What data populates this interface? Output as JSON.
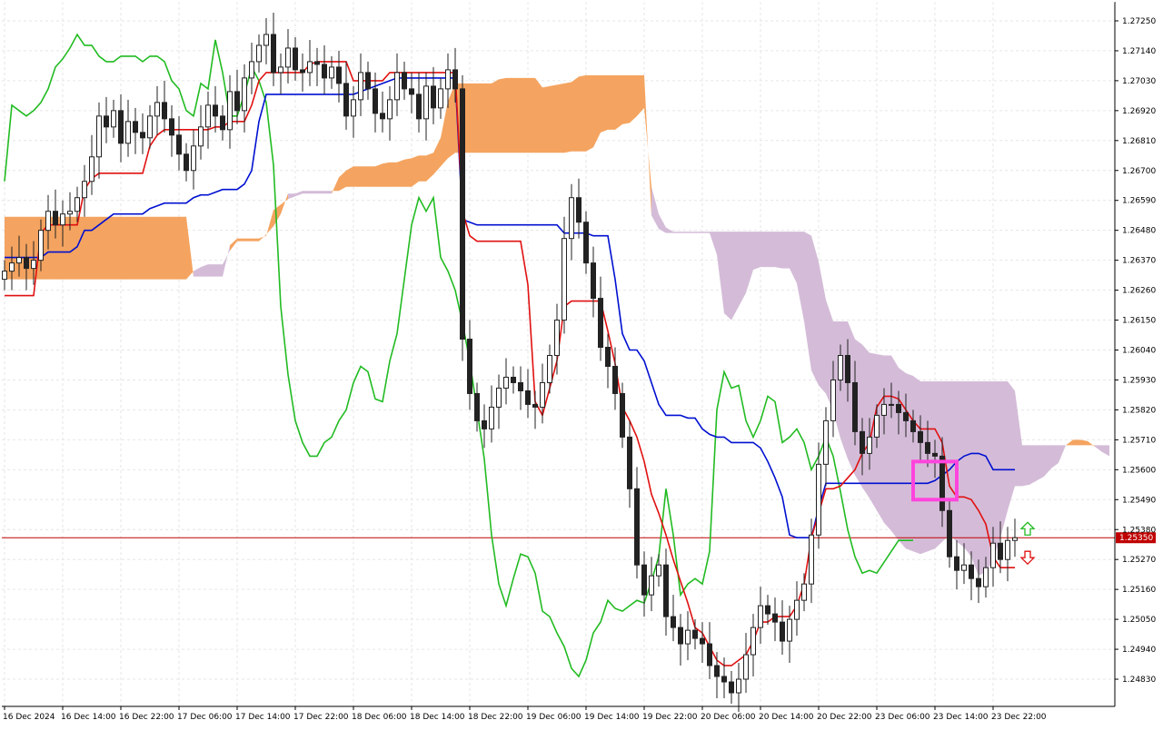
{
  "colors": {
    "background": "#ffffff",
    "grid": "#e6e6e6",
    "axis": "#000000",
    "candle_bull": "#ffffff",
    "candle_bear": "#222222",
    "candle_wick": "#222222",
    "tenkan": "#e01010",
    "kijun": "#0010d0",
    "chikou": "#22bb22",
    "cloud_bull": "#f4a460",
    "cloud_bear": "#d4bcd8",
    "price_line": "#c00000",
    "price_tag_bg": "#c00000",
    "highlight_box": "#ff44dd",
    "arrow_up": "#22bb22",
    "arrow_down": "#e01010"
  },
  "icons": {
    "up_arrow": "up-arrow-icon",
    "down_arrow": "down-arrow-icon"
  },
  "chart_data": {
    "type": "candlestick",
    "symbol": "",
    "y_axis": {
      "ylim": [
        1.2473,
        1.2732
      ],
      "ticks": [
        "1.27250",
        "1.27140",
        "1.27030",
        "1.26920",
        "1.26810",
        "1.26700",
        "1.26590",
        "1.26480",
        "1.26370",
        "1.26260",
        "1.26150",
        "1.26040",
        "1.25930",
        "1.25820",
        "1.25710",
        "1.25600",
        "1.25490",
        "1.25380",
        "1.25270",
        "1.25160",
        "1.25050",
        "1.24940",
        "1.24830"
      ]
    },
    "x_axis": {
      "ticks": [
        "16 Dec 2024",
        "16 Dec 14:00",
        "16 Dec 22:00",
        "17 Dec 06:00",
        "17 Dec 14:00",
        "17 Dec 22:00",
        "18 Dec 06:00",
        "18 Dec 14:00",
        "18 Dec 22:00",
        "19 Dec 06:00",
        "19 Dec 14:00",
        "19 Dec 22:00",
        "20 Dec 06:00",
        "20 Dec 14:00",
        "20 Dec 22:00",
        "23 Dec 06:00",
        "23 Dec 14:00",
        "23 Dec 22:00"
      ],
      "bars_per_tick": 8,
      "n_bars": 140
    },
    "current_price": "1.25350",
    "current_price_value": 1.2535,
    "closes": [
      1.2633,
      1.2636,
      1.2638,
      1.2634,
      1.2637,
      1.2648,
      1.2655,
      1.265,
      1.2654,
      1.2655,
      1.266,
      1.2666,
      1.2675,
      1.269,
      1.2686,
      1.2692,
      1.268,
      1.2688,
      1.2684,
      1.2682,
      1.269,
      1.2695,
      1.2689,
      1.2683,
      1.2676,
      1.267,
      1.2679,
      1.2686,
      1.2694,
      1.269,
      1.2685,
      1.2699,
      1.2692,
      1.2704,
      1.271,
      1.2716,
      1.272,
      1.2706,
      1.2708,
      1.2715,
      1.2707,
      1.2706,
      1.271,
      1.2709,
      1.2704,
      1.2708,
      1.2702,
      1.269,
      1.2696,
      1.2706,
      1.27,
      1.2691,
      1.2689,
      1.2696,
      1.2706,
      1.27,
      1.2698,
      1.2689,
      1.2701,
      1.2693,
      1.27,
      1.2707,
      1.27,
      1.2608,
      1.2588,
      1.2578,
      1.2575,
      1.2583,
      1.259,
      1.2594,
      1.2592,
      1.2589,
      1.2584,
      1.2583,
      1.2592,
      1.2602,
      1.2615,
      1.2645,
      1.266,
      1.2651,
      1.2636,
      1.2623,
      1.2605,
      1.2598,
      1.2588,
      1.2572,
      1.2553,
      1.2525,
      1.2514,
      1.2521,
      1.2525,
      1.2506,
      1.2502,
      1.2496,
      1.2501,
      1.2498,
      1.2496,
      1.2488,
      1.2484,
      1.2482,
      1.2478,
      1.2483,
      1.2492,
      1.2502,
      1.251,
      1.2507,
      1.2504,
      1.2497,
      1.2505,
      1.2512,
      1.2518,
      1.2536,
      1.2562,
      1.2578,
      1.2593,
      1.2602,
      1.2592,
      1.2574,
      1.2566,
      1.2572,
      1.258,
      1.2584,
      1.2584,
      1.2581,
      1.2578,
      1.2574,
      1.257,
      1.2566,
      1.2565,
      1.2545,
      1.2528,
      1.2523,
      1.2525,
      1.252,
      1.2517,
      1.2524,
      1.2533,
      1.2527,
      1.2534,
      1.2535
    ],
    "tenkan": [
      1.2624,
      1.2624,
      1.2624,
      1.2624,
      1.2624,
      1.2647,
      1.265,
      1.265,
      1.265,
      1.265,
      1.265,
      1.2663,
      1.2667,
      1.2669,
      1.2669,
      1.2669,
      1.2669,
      1.2669,
      1.2669,
      1.2669,
      1.2679,
      1.2683,
      1.2685,
      1.2685,
      1.2685,
      1.2685,
      1.2685,
      1.2685,
      1.2685,
      1.2686,
      1.2686,
      1.2688,
      1.2688,
      1.2688,
      1.2694,
      1.2703,
      1.2706,
      1.2706,
      1.2706,
      1.2706,
      1.2706,
      1.2706,
      1.2709,
      1.271,
      1.271,
      1.271,
      1.271,
      1.271,
      1.2703,
      1.2703,
      1.2703,
      1.2703,
      1.2703,
      1.2706,
      1.2706,
      1.2706,
      1.2706,
      1.2706,
      1.2706,
      1.2706,
      1.2706,
      1.2706,
      1.2706,
      1.2655,
      1.2646,
      1.2644,
      1.2644,
      1.2644,
      1.2644,
      1.2644,
      1.2644,
      1.2644,
      1.2628,
      1.2585,
      1.258,
      1.259,
      1.26,
      1.262,
      1.2622,
      1.2622,
      1.2622,
      1.2622,
      1.2622,
      1.2611,
      1.2599,
      1.2583,
      1.2578,
      1.2572,
      1.2563,
      1.2551,
      1.2544,
      1.2536,
      1.2527,
      1.2519,
      1.2511,
      1.2502,
      1.25,
      1.2495,
      1.249,
      1.2488,
      1.2488,
      1.249,
      1.2492,
      1.2497,
      1.2504,
      1.2504,
      1.2506,
      1.2506,
      1.2506,
      1.251,
      1.2518,
      1.2535,
      1.2544,
      1.2553,
      1.2553,
      1.2554,
      1.2557,
      1.256,
      1.2566,
      1.257,
      1.2583,
      1.2587,
      1.2587,
      1.2586,
      1.2582,
      1.2578,
      1.2575,
      1.2575,
      1.2575,
      1.257,
      1.2554,
      1.255,
      1.255,
      1.2549,
      1.2545,
      1.254,
      1.2528,
      1.2524,
      1.2524,
      1.2524
    ],
    "kijun": [
      1.2638,
      1.2638,
      1.2638,
      1.2638,
      1.2638,
      1.2638,
      1.264,
      1.264,
      1.264,
      1.264,
      1.2642,
      1.2648,
      1.2648,
      1.265,
      1.2652,
      1.2654,
      1.2654,
      1.2654,
      1.2654,
      1.2654,
      1.2656,
      1.2657,
      1.2658,
      1.2658,
      1.2658,
      1.2658,
      1.266,
      1.2661,
      1.2661,
      1.2662,
      1.2663,
      1.2663,
      1.2663,
      1.2665,
      1.267,
      1.2688,
      1.2698,
      1.2698,
      1.2698,
      1.2698,
      1.2698,
      1.2698,
      1.2698,
      1.2698,
      1.2698,
      1.2698,
      1.2698,
      1.2698,
      1.2698,
      1.2699,
      1.27,
      1.2701,
      1.2702,
      1.2703,
      1.2704,
      1.2704,
      1.2704,
      1.2704,
      1.2704,
      1.2704,
      1.2704,
      1.2704,
      1.2704,
      1.2652,
      1.2651,
      1.265,
      1.265,
      1.265,
      1.265,
      1.265,
      1.265,
      1.265,
      1.265,
      1.265,
      1.265,
      1.265,
      1.265,
      1.2647,
      1.2647,
      1.2647,
      1.2647,
      1.2646,
      1.2646,
      1.2646,
      1.263,
      1.261,
      1.2604,
      1.2604,
      1.26,
      1.2592,
      1.2584,
      1.258,
      1.258,
      1.258,
      1.2579,
      1.2579,
      1.2575,
      1.2573,
      1.2572,
      1.2572,
      1.257,
      1.257,
      1.257,
      1.257,
      1.2568,
      1.2563,
      1.2557,
      1.255,
      1.2536,
      1.2535,
      1.2535,
      1.2535,
      1.2546,
      1.2555,
      1.2555,
      1.2555,
      1.2555,
      1.2555,
      1.2555,
      1.2555,
      1.2555,
      1.2555,
      1.2555,
      1.2555,
      1.2555,
      1.2555,
      1.2555,
      1.2555,
      1.2556,
      1.2558,
      1.256,
      1.2563,
      1.2565,
      1.2566,
      1.2566,
      1.2565,
      1.256,
      1.256,
      1.256,
      1.256
    ],
    "chikou": [
      1.2666,
      1.2694,
      1.2692,
      1.269,
      1.2692,
      1.2695,
      1.27,
      1.2708,
      1.2711,
      1.2715,
      1.272,
      1.2716,
      1.2716,
      1.2712,
      1.271,
      1.271,
      1.2712,
      1.2712,
      1.2712,
      1.271,
      1.2712,
      1.2712,
      1.271,
      1.2703,
      1.27,
      1.2692,
      1.269,
      1.2702,
      1.27,
      1.2718,
      1.2706,
      1.269,
      1.269,
      1.2698,
      1.2708,
      1.2703,
      1.2695,
      1.2672,
      1.262,
      1.2595,
      1.2578,
      1.257,
      1.2565,
      1.2565,
      1.257,
      1.2572,
      1.2578,
      1.2582,
      1.2592,
      1.2598,
      1.2596,
      1.2586,
      1.2585,
      1.26,
      1.261,
      1.263,
      1.265,
      1.266,
      1.2655,
      1.266,
      1.2638,
      1.2633,
      1.2626,
      1.2614,
      1.26,
      1.2582,
      1.2564,
      1.2536,
      1.2518,
      1.251,
      1.252,
      1.2529,
      1.2528,
      1.2522,
      1.2508,
      1.2506,
      1.25,
      1.2495,
      1.2487,
      1.2484,
      1.249,
      1.25,
      1.2504,
      1.2512,
      1.2509,
      1.2508,
      1.251,
      1.2512,
      1.2511,
      1.2519,
      1.2528,
      1.2553,
      1.2536,
      1.2514,
      1.2518,
      1.252,
      1.2518,
      1.253,
      1.2582,
      1.2596,
      1.259,
      1.2591,
      1.2578,
      1.2572,
      1.2578,
      1.2587,
      1.2585,
      1.257,
      1.2572,
      1.2575,
      1.257,
      1.256,
      1.2565,
      1.2572,
      1.2565,
      1.2552,
      1.2538,
      1.2528,
      1.2522,
      1.2523,
      1.2522,
      1.2526,
      1.253,
      1.2534,
      1.2534,
      1.2534
    ]
  }
}
